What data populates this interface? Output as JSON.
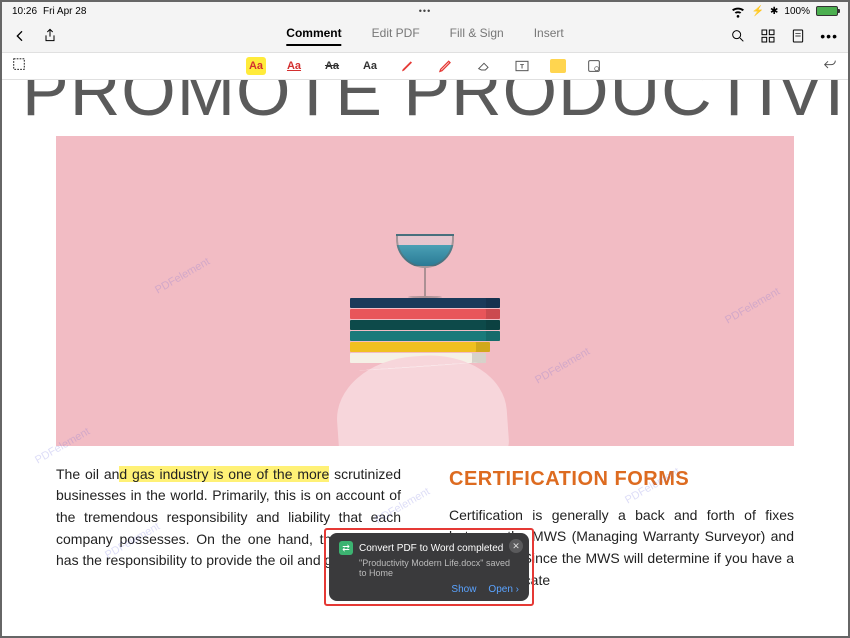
{
  "statusbar": {
    "time": "10:26",
    "date": "Fri Apr 28",
    "battery_pct": "100%"
  },
  "topbar": {
    "tabs": [
      {
        "label": "Comment",
        "active": true
      },
      {
        "label": "Edit PDF",
        "active": false
      },
      {
        "label": "Fill & Sign",
        "active": false
      },
      {
        "label": "Insert",
        "active": false
      }
    ]
  },
  "toolbar_labels": {
    "aa": "Aa"
  },
  "document": {
    "big_title": "PROMOTE PRODUCTIVITY",
    "watermark": "PDFelement",
    "left_col": {
      "prefix": "The oil an",
      "highlight1": "d gas industry is ",
      "mid": "",
      "highlight2": "one of the more",
      "rest": " scrutinized businesses in the world. Primarily, this is on account of the tremendous responsibility and liability that each company possesses. On the one hand, the business has the responsibility to provide the oil and gas"
    },
    "right_col": {
      "title": "CERTIFICATION FORMS",
      "body": "Certification is generally a back and forth of fixes between the MWS (Managing Warranty Surveyor) and the insurer. Since the MWS will determine if you have a COA (Certificate"
    }
  },
  "notification": {
    "title": "Convert PDF to Word completed",
    "subtitle": "\"Productivity Modern Life.docx\" saved to Home",
    "action_show": "Show",
    "action_open": "Open"
  }
}
